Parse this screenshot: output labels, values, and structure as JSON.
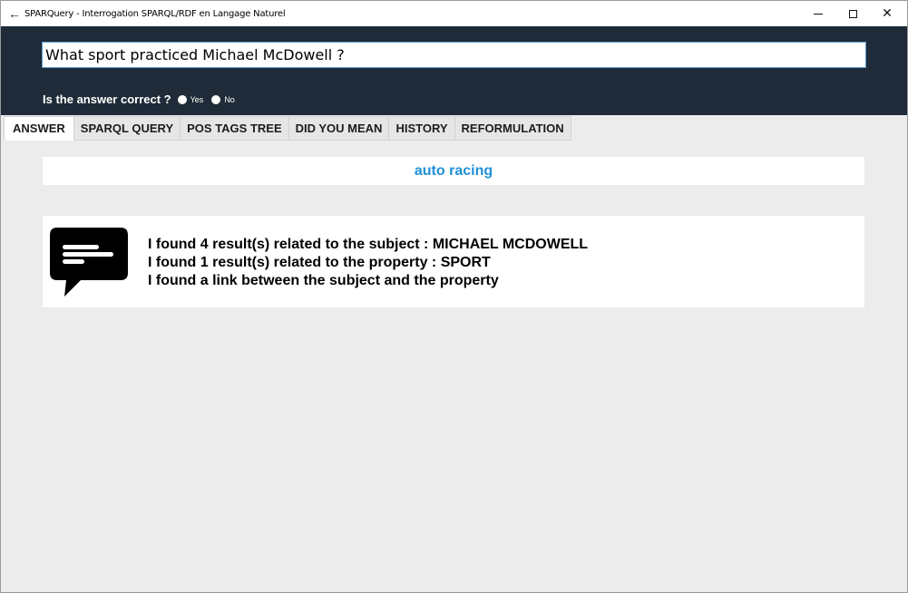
{
  "window": {
    "title": "SPARQuery - Interrogation SPARQL/RDF en Langage Naturel",
    "back_icon": "back-arrow-icon"
  },
  "search": {
    "value": "What sport practiced Michael McDowell ?",
    "placeholder": ""
  },
  "feedback": {
    "question": "Is the answer correct ?",
    "yes_label": "Yes",
    "no_label": "No"
  },
  "tabs": [
    {
      "label": "ANSWER",
      "active": true
    },
    {
      "label": "SPARQL QUERY",
      "active": false
    },
    {
      "label": "POS TAGS TREE",
      "active": false
    },
    {
      "label": "DID YOU MEAN",
      "active": false
    },
    {
      "label": "HISTORY",
      "active": false
    },
    {
      "label": "REFORMULATION",
      "active": false
    }
  ],
  "answer": {
    "value": "auto racing"
  },
  "info": {
    "icon": "chat-bubble-icon",
    "line1_prefix": "I found 4 result(s) related to the subject : ",
    "line1_value": "MICHAEL MCDOWELL",
    "line2_prefix": "I found 1 result(s) related to the property : ",
    "line2_value": "SPORT",
    "line3": "I found a link between the subject and the property"
  },
  "colors": {
    "header_bg": "#1f2b38",
    "answer_text": "#1e90d8",
    "content_bg": "#ececec"
  }
}
